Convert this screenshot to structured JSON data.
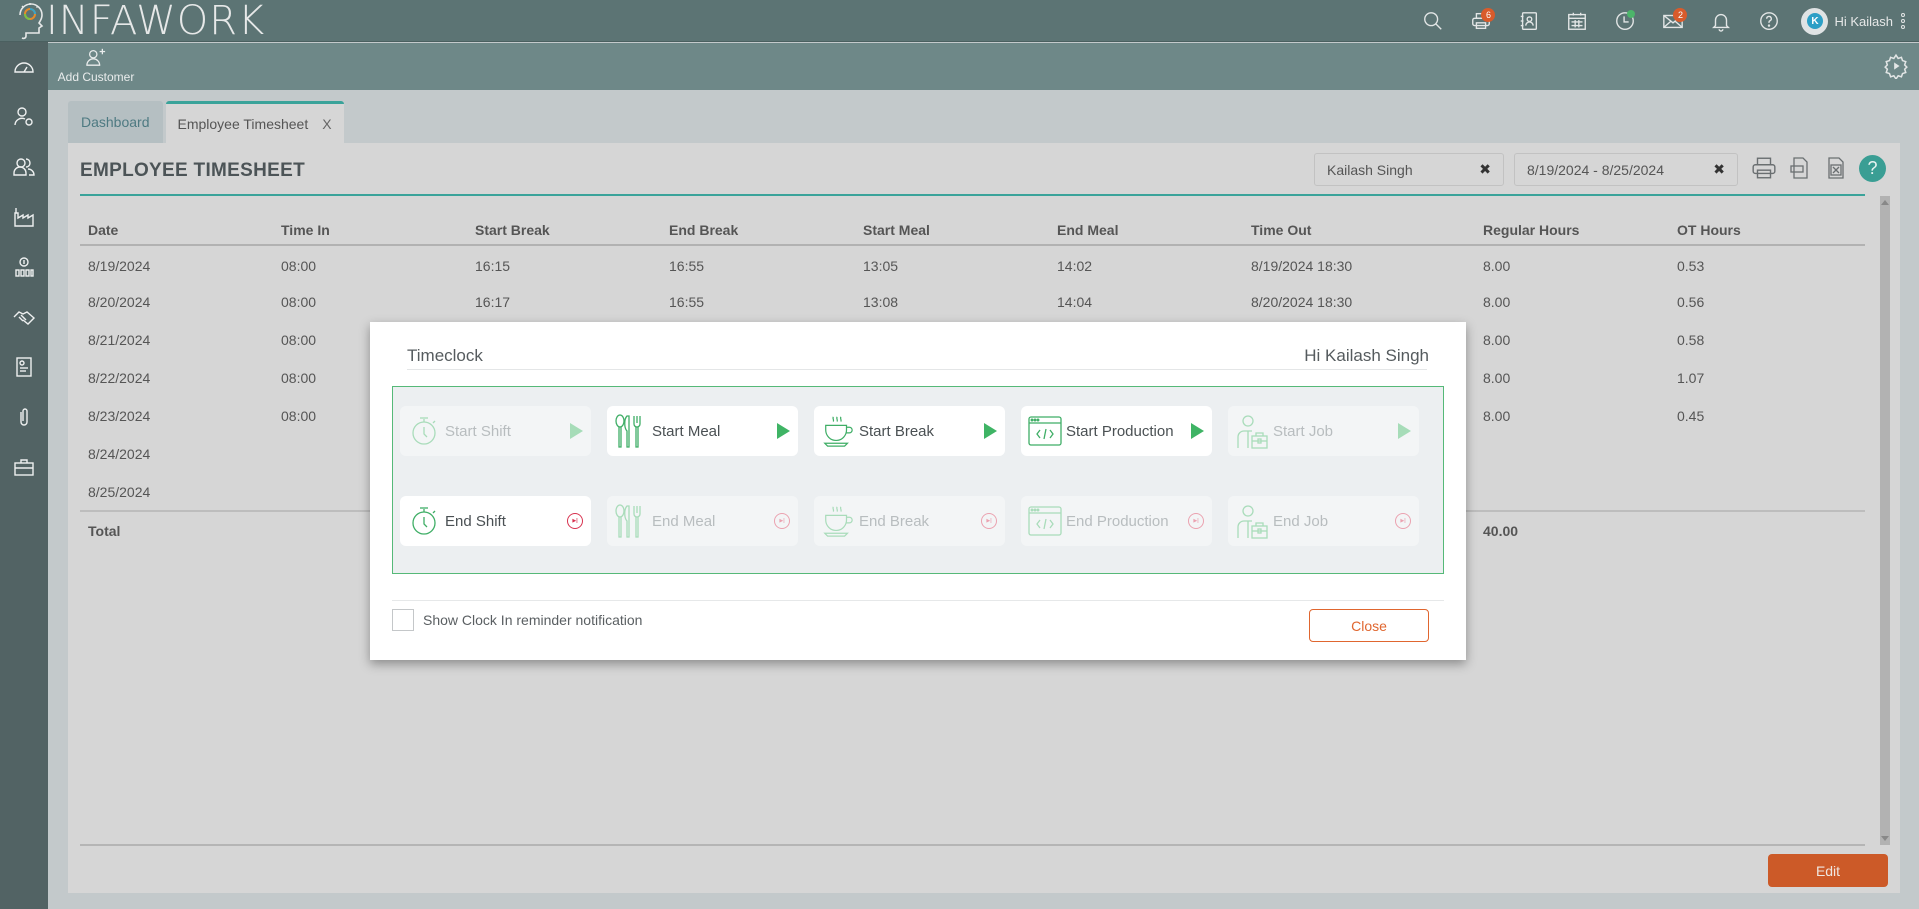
{
  "app": {
    "logo_text": "INFAWORK"
  },
  "topbar": {
    "icons": [
      {
        "name": "search-icon"
      },
      {
        "name": "printer-icon",
        "badge": "6"
      },
      {
        "name": "contacts-icon"
      },
      {
        "name": "calendar-icon"
      },
      {
        "name": "timeclock-icon",
        "status_dot": "#4cb56a"
      },
      {
        "name": "mail-icon",
        "badge": "2"
      },
      {
        "name": "bell-icon"
      },
      {
        "name": "help-icon"
      }
    ],
    "user": {
      "avatar_letter": "K",
      "greeting": "Hi Kailash"
    }
  },
  "sidebar": {
    "items": [
      {
        "name": "dashboard-icon"
      },
      {
        "name": "user-settings-icon"
      },
      {
        "name": "customers-icon"
      },
      {
        "name": "factory-icon"
      },
      {
        "name": "finance-icon"
      },
      {
        "name": "handshake-icon"
      },
      {
        "name": "document-icon"
      },
      {
        "name": "attachment-icon"
      },
      {
        "name": "briefcase-icon"
      }
    ]
  },
  "subbar": {
    "add_customer_label": "Add Customer"
  },
  "tabs": [
    {
      "label": "Dashboard",
      "active": false
    },
    {
      "label": "Employee Timesheet",
      "active": true,
      "close": "X"
    }
  ],
  "page": {
    "title": "EMPLOYEE TIMESHEET",
    "employee_filter": "Kailash Singh",
    "date_filter": "8/19/2024 - 8/25/2024",
    "clear_glyph": "✖",
    "help_glyph": "?",
    "edit_label": "Edit"
  },
  "table": {
    "columns": [
      "Date",
      "Time In",
      "Start Break",
      "End Break",
      "Start Meal",
      "End Meal",
      "Time Out",
      "Regular Hours",
      "OT Hours"
    ],
    "rows": [
      [
        "8/19/2024",
        "08:00",
        "16:15",
        "16:55",
        "13:05",
        "14:02",
        "8/19/2024 18:30",
        "8.00",
        "0.53"
      ],
      [
        "8/20/2024",
        "08:00",
        "16:17",
        "16:55",
        "13:08",
        "14:04",
        "8/20/2024 18:30",
        "8.00",
        "0.56"
      ],
      [
        "8/21/2024",
        "08:00",
        "",
        "",
        "",
        "",
        "",
        "8.00",
        "0.58"
      ],
      [
        "8/22/2024",
        "08:00",
        "",
        "",
        "",
        "",
        "",
        "8.00",
        "1.07"
      ],
      [
        "8/23/2024",
        "08:00",
        "",
        "",
        "",
        "",
        "",
        "8.00",
        "0.45"
      ],
      [
        "8/24/2024",
        "",
        "",
        "",
        "",
        "",
        "",
        "",
        ""
      ],
      [
        "8/25/2024",
        "",
        "",
        "",
        "",
        "",
        "",
        "",
        ""
      ]
    ],
    "total": {
      "label": "Total",
      "regular_hours": "40.00",
      "ot_hours": ""
    }
  },
  "modal": {
    "title": "Timeclock",
    "greeting": "Hi Kailash Singh",
    "start_buttons": [
      {
        "label": "Start Shift",
        "enabled": false,
        "icon": "stopwatch-icon"
      },
      {
        "label": "Start Meal",
        "enabled": true,
        "icon": "cutlery-icon"
      },
      {
        "label": "Start Break",
        "enabled": true,
        "icon": "coffee-cup-icon"
      },
      {
        "label": "Start Production",
        "enabled": true,
        "icon": "code-window-icon"
      },
      {
        "label": "Start Job",
        "enabled": false,
        "icon": "worker-briefcase-icon"
      }
    ],
    "end_buttons": [
      {
        "label": "End Shift",
        "enabled": true,
        "icon": "stopwatch-icon"
      },
      {
        "label": "End Meal",
        "enabled": false,
        "icon": "cutlery-icon"
      },
      {
        "label": "End Break",
        "enabled": false,
        "icon": "coffee-cup-icon"
      },
      {
        "label": "End Production",
        "enabled": false,
        "icon": "code-window-icon"
      },
      {
        "label": "End Job",
        "enabled": false,
        "icon": "worker-briefcase-icon"
      }
    ],
    "reminder_label": "Show Clock In reminder notification",
    "reminder_checked": false,
    "close_label": "Close"
  },
  "colors": {
    "accent_teal": "#3aa39a",
    "topbar": "#5c7474",
    "sidebar": "#526364",
    "edit_button": "#cc5a28",
    "close_button": "#e0662f",
    "play_green": "#3fb465",
    "stop_red": "#d83350"
  }
}
